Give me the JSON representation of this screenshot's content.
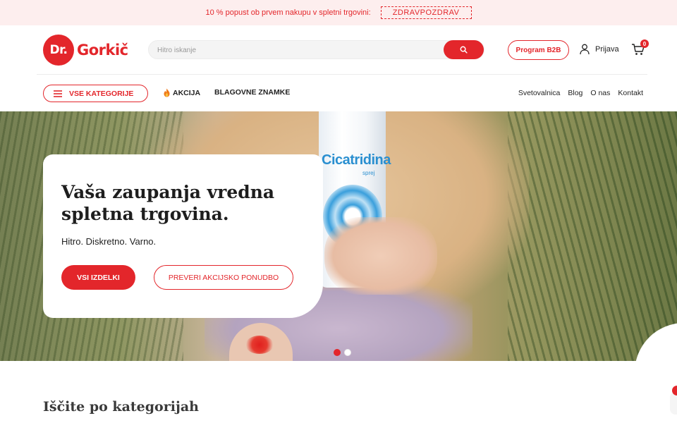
{
  "promo": {
    "text": "10 % popust ob prvem nakupu v spletni trgovini:",
    "code": "ZDRAVPOZDRAV"
  },
  "header": {
    "logo_prefix": "Dr.",
    "logo_name": "Gorkič",
    "search_placeholder": "Hitro iskanje",
    "search_icon": "search-icon",
    "b2b_label": "Program B2B",
    "login_label": "Prijava",
    "login_icon": "user-icon",
    "cart_icon": "cart-icon",
    "cart_count": "0"
  },
  "nav": {
    "categories_label": "VSE KATEGORIJE",
    "categories_icon": "hamburger-menu-icon",
    "akcija_label": "AKCIJA",
    "akcija_icon": "fire-icon",
    "brands_label": "BLAGOVNE ZNAMKE",
    "links": [
      "Svetovalnica",
      "Blog",
      "O nas",
      "Kontakt"
    ]
  },
  "hero": {
    "title": "Vaša zaupanja vredna spletna trgovina.",
    "subtitle": "Hitro. Diskretno. Varno.",
    "primary_button": "VSI IZDELKI",
    "secondary_button": "PREVERI AKCIJSKO PONUDBO",
    "product_label": "Cicatridina",
    "product_sub": "sprej",
    "slides_total": 2,
    "active_slide": 1
  },
  "section": {
    "title": "Iščite po kategorijah"
  },
  "colors": {
    "accent": "#e3262b",
    "promo_bg": "#fdeeee",
    "text": "#222222"
  }
}
